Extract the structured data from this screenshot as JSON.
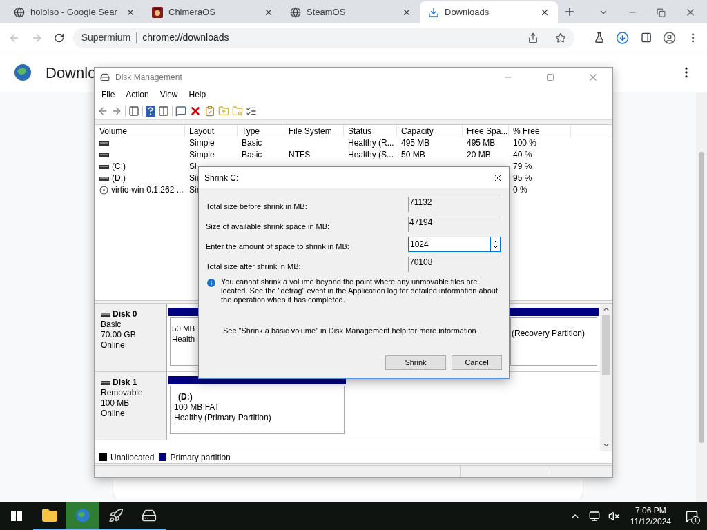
{
  "browser": {
    "tabs": [
      {
        "label": "holoiso - Google Sear",
        "selected": false,
        "kind": "globe"
      },
      {
        "label": "ChimeraOS",
        "selected": false,
        "kind": "logo"
      },
      {
        "label": "SteamOS",
        "selected": false,
        "kind": "globe"
      },
      {
        "label": "Downloads",
        "selected": true,
        "kind": "download"
      }
    ],
    "address": {
      "site": "Supermium",
      "url": "chrome://downloads"
    },
    "page_title": "Downlo"
  },
  "disk_management": {
    "title": "Disk Management",
    "menu": [
      "File",
      "Action",
      "View",
      "Help"
    ],
    "columns": [
      "Volume",
      "Layout",
      "Type",
      "File System",
      "Status",
      "Capacity",
      "Free Spa...",
      "% Free"
    ],
    "rows": [
      {
        "kind": "drive",
        "layout": "Simple",
        "type": "Basic",
        "status": "Healthy (R...",
        "capacity": "495 MB",
        "free": "495 MB",
        "pct": "100 %"
      },
      {
        "kind": "drive",
        "layout": "Simple",
        "type": "Basic",
        "fs": "NTFS",
        "status": "Healthy (S...",
        "capacity": "50 MB",
        "free": "20 MB",
        "pct": "40 %"
      },
      {
        "kind": "drive",
        "volume": "(C:)",
        "layout": "Si",
        "pct": "79 %"
      },
      {
        "kind": "drive",
        "volume": "(D:)",
        "layout": "Sir",
        "pct": "95 %"
      },
      {
        "kind": "disc",
        "volume": "virtio-win-0.1.262 ...",
        "layout": "Sir",
        "pct": "0 %"
      }
    ],
    "disks": [
      {
        "name": "Disk 0",
        "type": "Basic",
        "size": "70.00 GB",
        "state": "Online",
        "partitions": [
          {
            "lines": [
              "50 MB",
              "Health"
            ]
          },
          {
            "lines": [
              "(Recovery Partition)"
            ]
          }
        ]
      },
      {
        "name": "Disk 1",
        "type": "Removable",
        "size": "100 MB",
        "state": "Online",
        "partitions": [
          {
            "name": "(D:)",
            "lines": [
              "100 MB FAT",
              "Healthy (Primary Partition)"
            ]
          }
        ]
      }
    ],
    "legend": [
      {
        "label": "Unallocated",
        "color": "#000000"
      },
      {
        "label": "Primary partition",
        "color": "#000080"
      }
    ]
  },
  "dialog": {
    "title": "Shrink C:",
    "fields": [
      {
        "label": "Total size before shrink in MB:",
        "value": "71132",
        "kind": "readonly"
      },
      {
        "label": "Size of available shrink space in MB:",
        "value": "47194",
        "kind": "readonly"
      },
      {
        "label": "Enter the amount of space to shrink in MB:",
        "value": "1024",
        "kind": "spin"
      },
      {
        "label": "Total size after shrink in MB:",
        "value": "70108",
        "kind": "readonly"
      }
    ],
    "info": "You cannot shrink a volume beyond the point where any unmovable files are located. See the \"defrag\" event in the Application log for detailed information about the operation when it has completed.",
    "help": "See \"Shrink a basic volume\" in Disk Management help for more information",
    "buttons": [
      "Shrink",
      "Cancel"
    ]
  },
  "taskbar": {
    "apps": [
      {
        "kind": "explorer",
        "selected": false
      },
      {
        "kind": "browser",
        "selected": true
      },
      {
        "kind": "rocket",
        "selected": false
      },
      {
        "kind": "disk",
        "selected": false
      }
    ],
    "time": "7:06 PM",
    "date": "11/12/2024",
    "notifications": "1"
  }
}
